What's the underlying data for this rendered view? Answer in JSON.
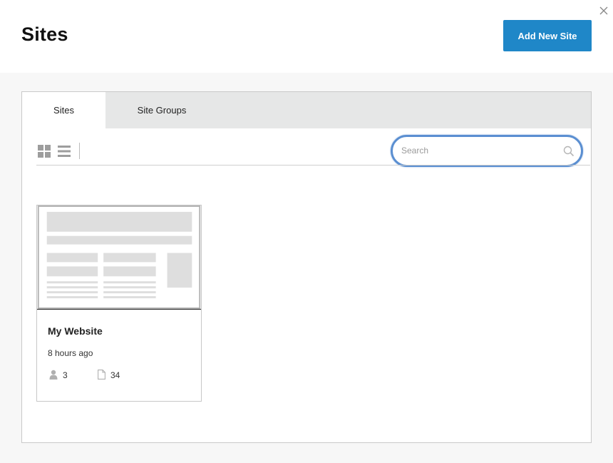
{
  "header": {
    "title": "Sites",
    "add_button_label": "Add New Site"
  },
  "tabs": [
    {
      "label": "Sites",
      "active": true
    },
    {
      "label": "Site Groups",
      "active": false
    }
  ],
  "search": {
    "placeholder": "Search",
    "value": ""
  },
  "sites": [
    {
      "name": "My Website",
      "updated": "8 hours ago",
      "users": "3",
      "pages": "34"
    }
  ],
  "icons": {
    "close": "close-icon",
    "grid_view": "grid-view-icon",
    "list_view": "list-view-icon",
    "search": "search-icon",
    "user": "user-icon",
    "page": "page-icon"
  },
  "colors": {
    "accent": "#1f87c8",
    "search_focus": "#5b8fd1",
    "tab_bar": "#e6e7e7",
    "background": "#f7f7f7"
  }
}
